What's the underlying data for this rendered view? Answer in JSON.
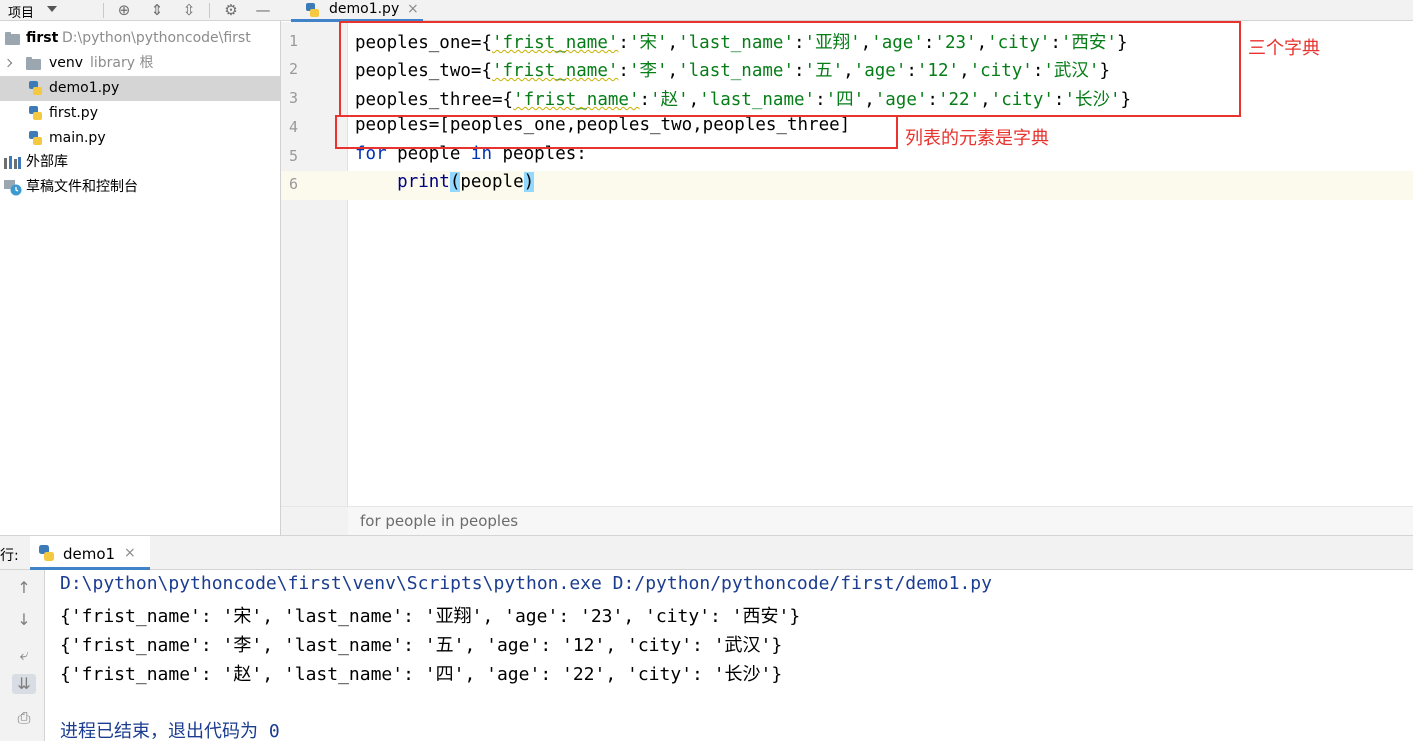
{
  "project_panel": {
    "title": "项目",
    "tree": [
      {
        "label": "first",
        "sub": "D:\\python\\pythoncode\\first",
        "type": "root"
      },
      {
        "label": "venv",
        "sub": "library 根",
        "type": "folder"
      },
      {
        "label": "demo1.py",
        "type": "file",
        "selected": true
      },
      {
        "label": "first.py",
        "type": "file"
      },
      {
        "label": "main.py",
        "type": "file"
      },
      {
        "label": "外部库",
        "type": "libs"
      },
      {
        "label": "草稿文件和控制台",
        "type": "scratch"
      }
    ]
  },
  "editor": {
    "tab_label": "demo1.py",
    "tab_close": "×",
    "line_numbers": [
      "1",
      "2",
      "3",
      "4",
      "5",
      "6"
    ],
    "lines": [
      {
        "var": "peoples_one",
        "k1": "'frist_name'",
        "v1": "'宋'",
        "k2": "'last_name'",
        "v2": "'亚翔'",
        "k3": "'age'",
        "v3": "'23'",
        "k4": "'city'",
        "v4": "'西安'"
      },
      {
        "var": "peoples_two",
        "k1": "'frist_name'",
        "v1": "'李'",
        "k2": "'last_name'",
        "v2": "'五'",
        "k3": "'age'",
        "v3": "'12'",
        "k4": "'city'",
        "v4": "'武汉'"
      },
      {
        "var": "peoples_three",
        "k1": "'frist_name'",
        "v1": "'赵'",
        "k2": "'last_name'",
        "v2": "'四'",
        "k3": "'age'",
        "v3": "'22'",
        "k4": "'city'",
        "v4": "'长沙'"
      }
    ],
    "line4": "peoples=[peoples_one,peoples_two,peoples_three]",
    "line5": {
      "kw_for": "for",
      "mid": " people ",
      "kw_in": "in",
      "rest": " peoples:"
    },
    "line6": {
      "indent": "    ",
      "func": "print",
      "open": "(",
      "arg": "people",
      "close": ")"
    },
    "breadcrumb": "for people in peoples"
  },
  "annotations": {
    "dicts_label": "三个字典",
    "list_label": "列表的元素是字典"
  },
  "run_panel": {
    "label": "行:",
    "tab_label": "demo1",
    "tab_close": "×",
    "command": "D:\\python\\pythoncode\\first\\venv\\Scripts\\python.exe D:/python/pythoncode/first/demo1.py",
    "output_lines": [
      "{'frist_name': '宋', 'last_name': '亚翔', 'age': '23', 'city': '西安'}",
      "{'frist_name': '李', 'last_name': '五', 'age': '12', 'city': '武汉'}",
      "{'frist_name': '赵', 'last_name': '四', 'age': '22', 'city': '长沙'}"
    ],
    "exit_message": "进程已结束，退出代码为 0"
  },
  "icons": {
    "toolbar": [
      "locate-icon",
      "expand-all-icon",
      "collapse-all-icon",
      "gear-icon",
      "minimize-icon"
    ],
    "run_sidebar": [
      "up-arrow-icon",
      "down-arrow-icon",
      "soft-wrap-icon",
      "scroll-to-end-icon",
      "print-icon"
    ]
  },
  "colors": {
    "annotation": "#e8332e",
    "string": "#067d17",
    "keyword": "#0033b3",
    "accent": "#4083c9"
  }
}
